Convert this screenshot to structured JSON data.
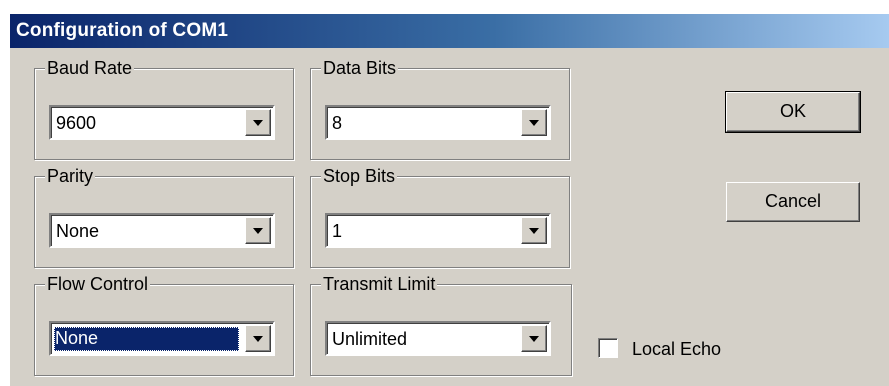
{
  "window": {
    "title": "Configuration of COM1"
  },
  "groups": {
    "baud_rate": {
      "label": "Baud Rate",
      "value": "9600"
    },
    "data_bits": {
      "label": "Data Bits",
      "value": "8"
    },
    "parity": {
      "label": "Parity",
      "value": "None"
    },
    "stop_bits": {
      "label": "Stop Bits",
      "value": "1"
    },
    "flow_control": {
      "label": "Flow Control",
      "value": "None"
    },
    "transmit_limit": {
      "label": "Transmit Limit",
      "value": "Unlimited"
    }
  },
  "buttons": {
    "ok_label": "OK",
    "cancel_label": "Cancel"
  },
  "local_echo": {
    "label": "Local Echo",
    "checked": false
  },
  "icons": [
    "chevron-down-icon"
  ],
  "colors": {
    "titlebar_start": "#0a246a",
    "titlebar_end": "#a6caf0",
    "dialog_bg": "#d4d0c8",
    "selection": "#0a246a"
  }
}
